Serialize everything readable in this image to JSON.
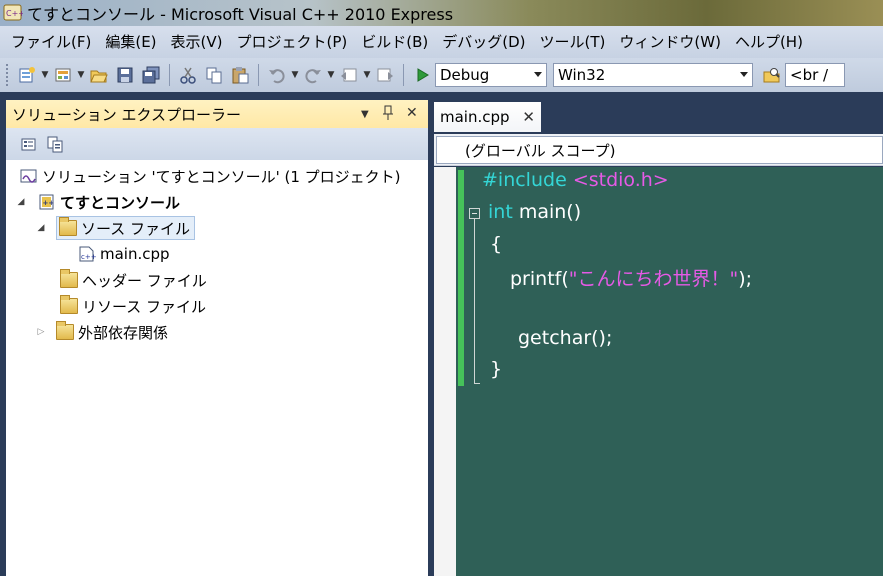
{
  "window": {
    "title": "てすとコンソール - Microsoft Visual C++ 2010 Express"
  },
  "menu": {
    "items": [
      "ファイル(F)",
      "編集(E)",
      "表示(V)",
      "プロジェクト(P)",
      "ビルド(B)",
      "デバッグ(D)",
      "ツール(T)",
      "ウィンドウ(W)",
      "ヘルプ(H)"
    ]
  },
  "toolbar": {
    "config_combo": "Debug",
    "platform_combo": "Win32",
    "find_combo": "<br /",
    "icons": [
      "new-project-icon",
      "add-item-icon",
      "open-icon",
      "save-icon",
      "save-all-icon",
      "cut-icon",
      "copy-icon",
      "paste-icon",
      "undo-icon",
      "redo-icon",
      "navigate-back-icon",
      "navigate-forward-icon",
      "start-debugging-icon",
      "find-in-files-icon"
    ]
  },
  "solution_explorer": {
    "title": "ソリューション エクスプローラー",
    "solution_label": "ソリューション 'てすとコンソール' (1 プロジェクト)",
    "project_label": "てすとコンソール",
    "tree": [
      {
        "label": "ソース ファイル",
        "selected": true
      },
      {
        "label": "main.cpp"
      },
      {
        "label": "ヘッダー ファイル"
      },
      {
        "label": "リソース ファイル"
      },
      {
        "label": "外部依存関係"
      }
    ]
  },
  "editor": {
    "tab_label": "main.cpp",
    "scope": "(グローバル スコープ)",
    "code": {
      "l1_directive": "#include",
      "l1_header": "<stdio.h>",
      "l2_keyword": "int",
      "l2_rest": "main()",
      "l3": "{",
      "l4_call": "printf(",
      "l4_string": "\"こんにちわ世界！\"",
      "l4_end": ");",
      "l6": "getchar();",
      "l7": "}"
    }
  },
  "colors": {
    "code_background": "#2f6057",
    "keyword": "#34d6d6",
    "string": "#e65ae6",
    "change_marker": "#46c25a",
    "explorer_header": "#ffe8a6"
  }
}
